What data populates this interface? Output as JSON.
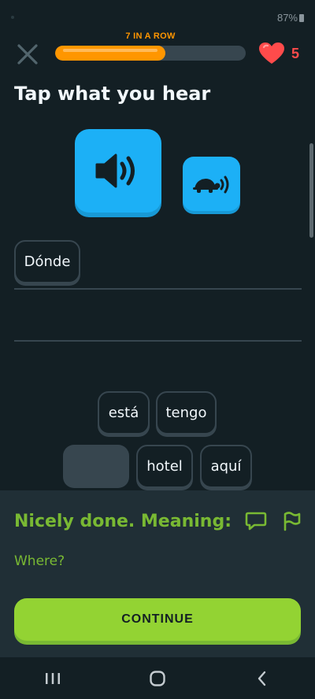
{
  "status_bar": {
    "battery": "87%"
  },
  "header": {
    "close_icon": "close-icon",
    "streak_label": "7 IN A ROW",
    "progress": 0.58,
    "hearts_icon": "heart-icon",
    "hearts_count": "5"
  },
  "prompt": {
    "title": "Tap what you hear",
    "speaker_icon": "speaker-icon",
    "slow_speaker_icon": "turtle-speaker-icon"
  },
  "answer": {
    "words": [
      "Dónde"
    ]
  },
  "word_bank": {
    "row1": [
      "está",
      "tengo"
    ],
    "row2": [
      "hotel",
      "aquí"
    ]
  },
  "feedback": {
    "title": "Nicely done. Meaning:",
    "meaning": "Where?",
    "discuss_icon": "comment-icon",
    "report_icon": "flag-icon",
    "continue_label": "CONTINUE"
  },
  "colors": {
    "background": "#131f24",
    "accent_blue": "#1cb0f6",
    "accent_green": "#93d333",
    "streak_orange": "#ff9600",
    "heart_red": "#ff4b4b"
  }
}
